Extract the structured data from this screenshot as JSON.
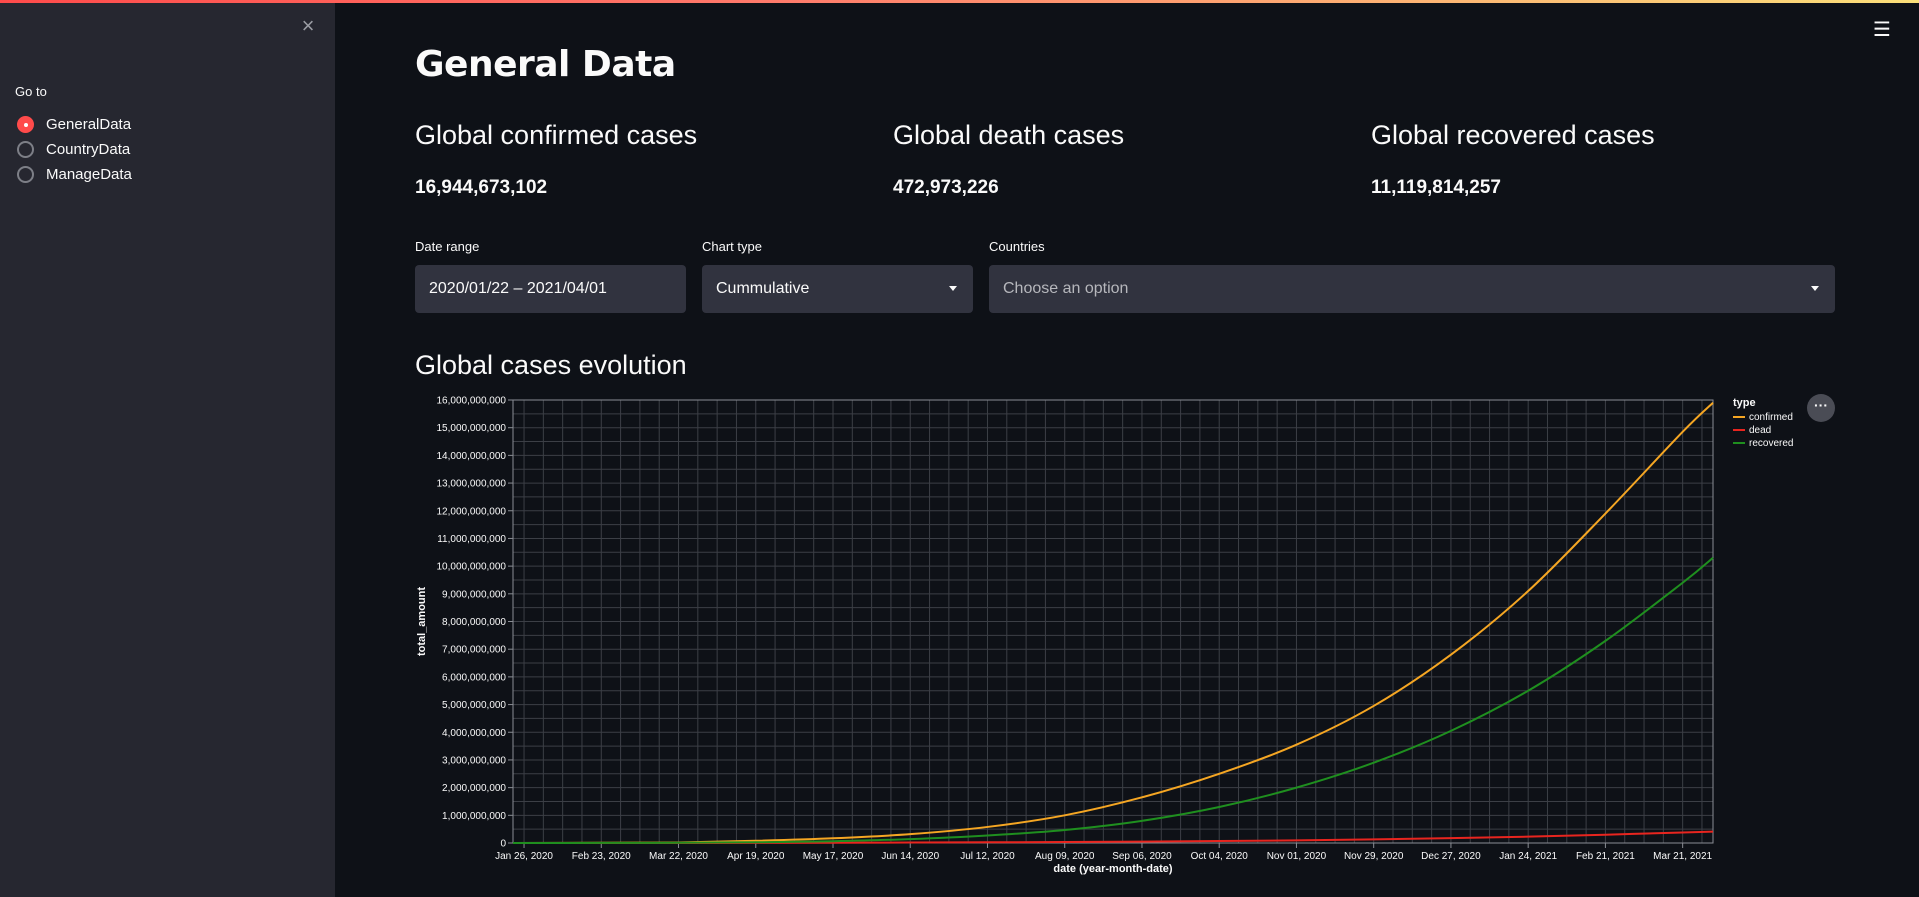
{
  "sidebar": {
    "close_icon": "×",
    "goto_label": "Go to",
    "options": [
      {
        "label": "GeneralData",
        "selected": true
      },
      {
        "label": "CountryData",
        "selected": false
      },
      {
        "label": "ManageData",
        "selected": false
      }
    ]
  },
  "header": {
    "menu_icon": "☰"
  },
  "main": {
    "title": "General Data",
    "metrics": [
      {
        "label": "Global confirmed cases",
        "value": "16,944,673,102"
      },
      {
        "label": "Global death cases",
        "value": "472,973,226"
      },
      {
        "label": "Global recovered cases",
        "value": "11,119,814,257"
      }
    ],
    "filters": {
      "date_range": {
        "label": "Date range",
        "value": "2020/01/22 – 2021/04/01"
      },
      "chart_type": {
        "label": "Chart type",
        "value": "Cummulative"
      },
      "countries": {
        "label": "Countries",
        "placeholder": "Choose an option"
      }
    },
    "chart_heading": "Global cases evolution",
    "chart_menu_icon": "···"
  },
  "colors": {
    "accent": "#ff4b4b",
    "confirmed": "#f5a623",
    "dead": "#e8251f",
    "recovered": "#1f8f1f"
  },
  "chart_data": {
    "type": "line",
    "xlabel": "date (year-month-date)",
    "ylabel": "total_amount",
    "ylim": [
      0,
      16000000000
    ],
    "xlim": [
      "2020-01-22",
      "2021-04-01"
    ],
    "x_ticks": [
      "Jan 26, 2020",
      "Feb 23, 2020",
      "Mar 22, 2020",
      "Apr 19, 2020",
      "May 17, 2020",
      "Jun 14, 2020",
      "Jul 12, 2020",
      "Aug 09, 2020",
      "Sep 06, 2020",
      "Oct 04, 2020",
      "Nov 01, 2020",
      "Nov 29, 2020",
      "Dec 27, 2020",
      "Jan 24, 2021",
      "Feb 21, 2021",
      "Mar 21, 2021"
    ],
    "y_ticks": [
      "0",
      "1,000,000,000",
      "2,000,000,000",
      "3,000,000,000",
      "4,000,000,000",
      "5,000,000,000",
      "6,000,000,000",
      "7,000,000,000",
      "8,000,000,000",
      "9,000,000,000",
      "10,000,000,000",
      "11,000,000,000",
      "12,000,000,000",
      "13,000,000,000",
      "14,000,000,000",
      "15,000,000,000",
      "16,000,000,000"
    ],
    "grid": true,
    "legend": {
      "title": "type",
      "placement": "right"
    },
    "x": [
      "2020-01-22",
      "2020-02-23",
      "2020-03-22",
      "2020-04-19",
      "2020-05-17",
      "2020-06-14",
      "2020-07-12",
      "2020-08-09",
      "2020-09-06",
      "2020-10-04",
      "2020-11-01",
      "2020-11-29",
      "2020-12-27",
      "2021-01-24",
      "2021-02-21",
      "2021-03-21",
      "2021-04-01"
    ],
    "series": [
      {
        "name": "confirmed",
        "values": [
          0,
          10000000,
          20000000,
          80000000,
          170000000,
          320000000,
          580000000,
          1000000000,
          1650000000,
          2500000000,
          3550000000,
          4950000000,
          6800000000,
          9100000000,
          11900000000,
          14850000000,
          15900000000
        ]
      },
      {
        "name": "dead",
        "values": [
          0,
          300000,
          800000,
          4000000,
          10000000,
          17000000,
          25000000,
          35000000,
          50000000,
          70000000,
          95000000,
          130000000,
          175000000,
          230000000,
          300000000,
          380000000,
          410000000
        ]
      },
      {
        "name": "recovered",
        "values": [
          0,
          3000000,
          8000000,
          25000000,
          65000000,
          140000000,
          270000000,
          470000000,
          800000000,
          1300000000,
          2000000000,
          2900000000,
          4050000000,
          5500000000,
          7300000000,
          9400000000,
          10300000000
        ]
      }
    ]
  }
}
